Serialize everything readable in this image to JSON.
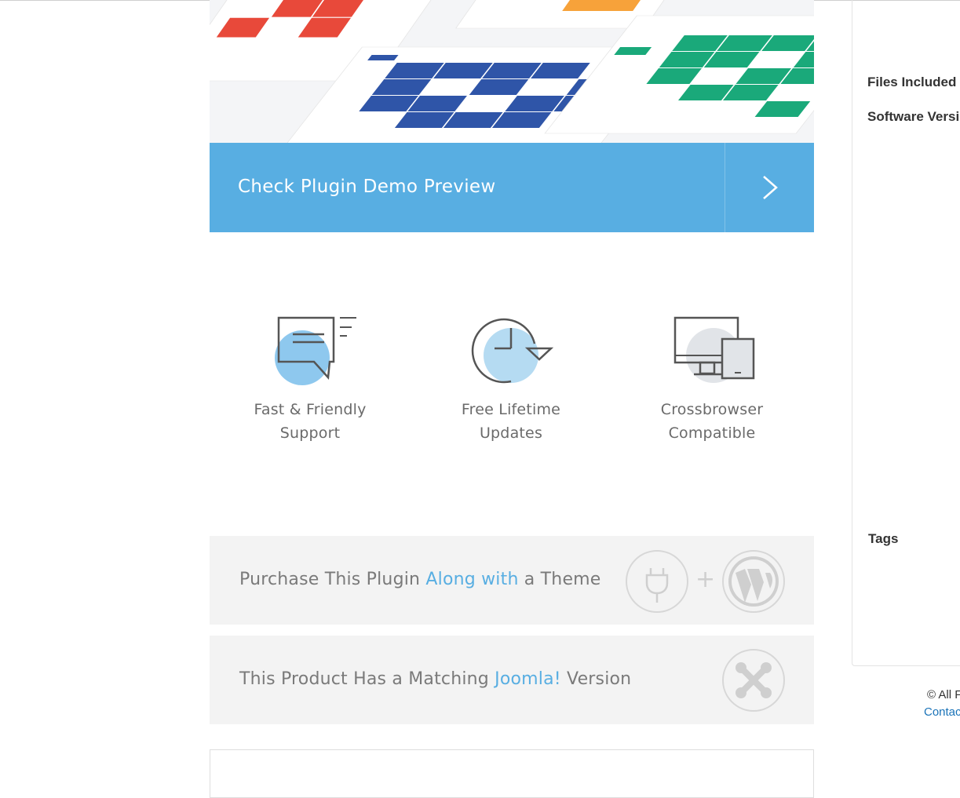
{
  "demo": {
    "label": "Check Plugin Demo Preview"
  },
  "features": [
    {
      "line1": "Fast & Friendly",
      "line2": "Support"
    },
    {
      "line1": "Free Lifetime",
      "line2": "Updates"
    },
    {
      "line1": "Crossbrowser",
      "line2": "Compatible"
    }
  ],
  "promo_theme": {
    "before": "Purchase This Plugin ",
    "highlight": "Along with",
    "after": " a Theme",
    "plus": "+"
  },
  "promo_joomla": {
    "before": "This Product Has a Matching ",
    "highlight": "Joomla!",
    "after": " Version"
  },
  "sidebar": {
    "files_included": "Files Included",
    "software_version": "Software Versi",
    "tags": "Tags"
  },
  "footer": {
    "copyright": "© All F",
    "contact": "Contac"
  },
  "colors": {
    "accent": "#58aee2",
    "red": "#e8493a",
    "blue": "#2f55a8",
    "green": "#1aa97a",
    "orange": "#f7a23a"
  },
  "icons": [
    "chevron-right-icon",
    "chat-support-icon",
    "clock-update-icon",
    "devices-icon",
    "plug-icon",
    "wordpress-icon",
    "joomla-icon"
  ]
}
